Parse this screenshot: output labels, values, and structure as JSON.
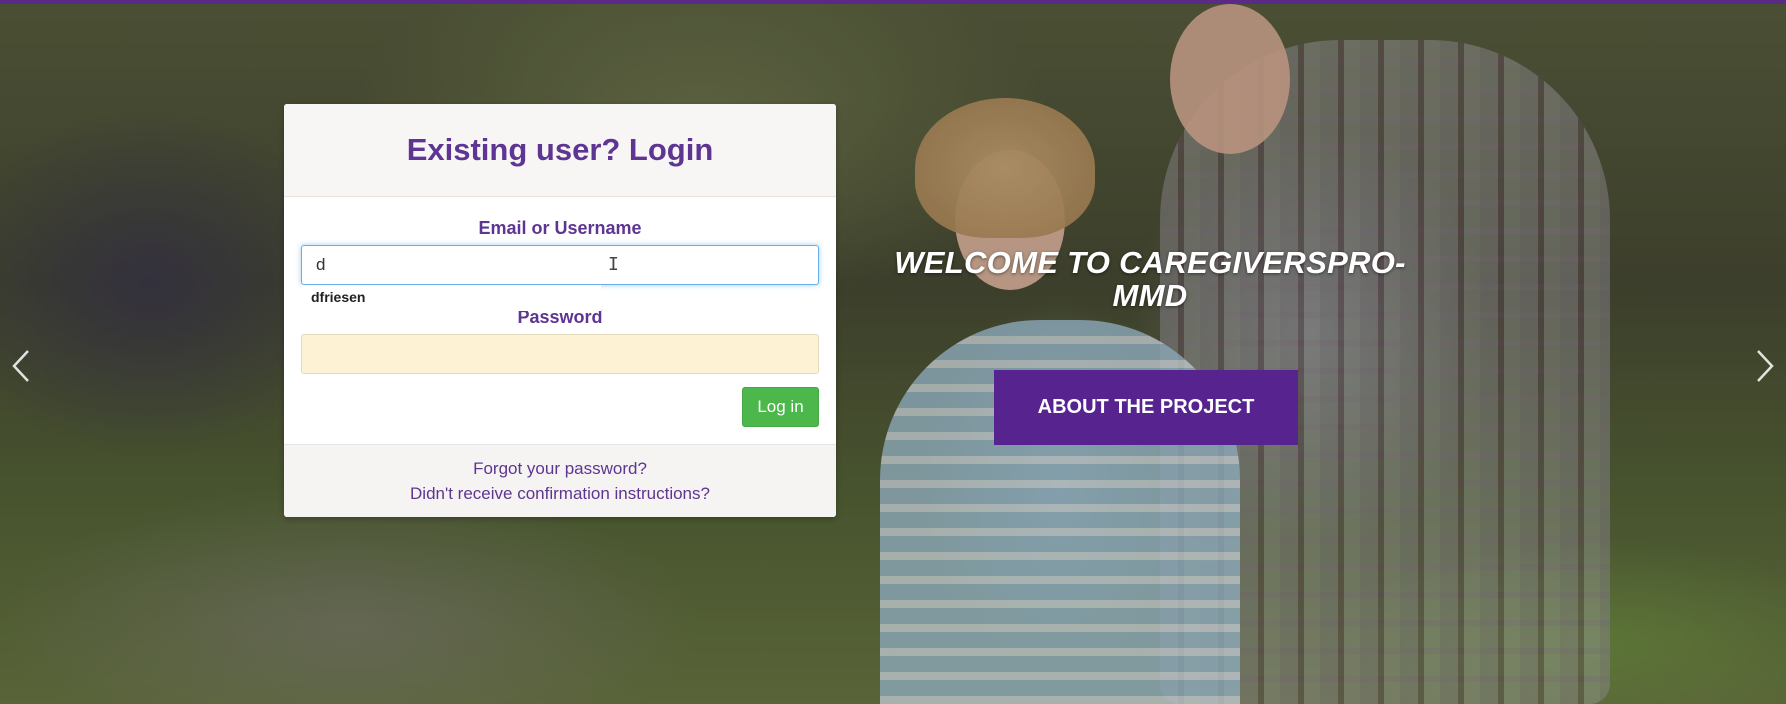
{
  "page": {
    "accent_color": "#5b2a86",
    "button_green": "#4cb84c"
  },
  "hero": {
    "title": "WELCOME TO CAREGIVERSPRO-MMD",
    "about_button": "ABOUT THE PROJECT",
    "prev_icon": "chevron-left-icon",
    "next_icon": "chevron-right-icon"
  },
  "login": {
    "title": "Existing user? Login",
    "email_label": "Email or Username",
    "email_value": "d",
    "autocomplete_suggestion": "dfriesen",
    "password_label": "Password",
    "password_value": "",
    "submit_label": "Log in",
    "forgot_password": "Forgot your password?",
    "confirmation_instructions": "Didn't receive confirmation instructions?"
  }
}
